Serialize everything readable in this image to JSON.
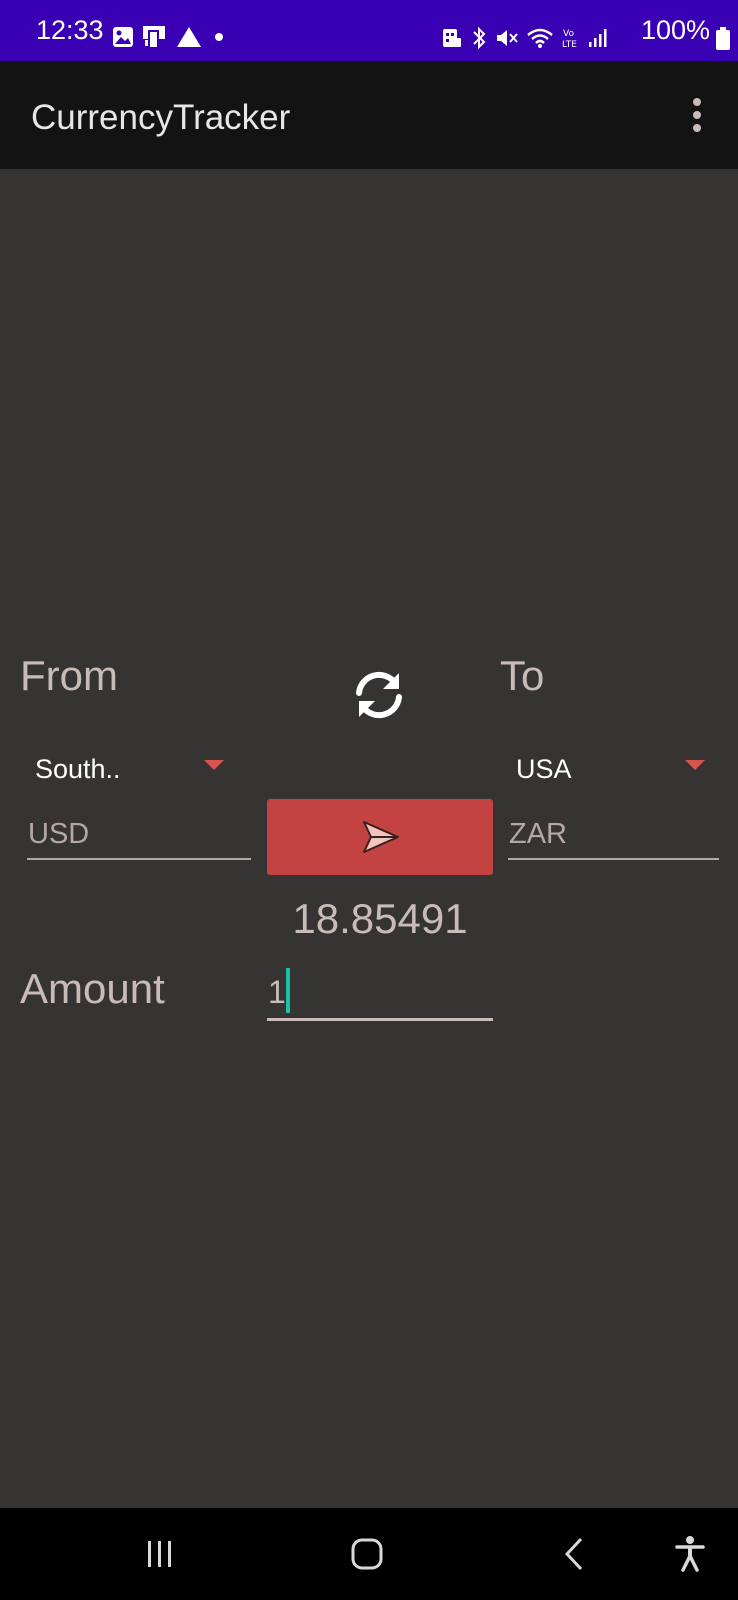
{
  "status_bar": {
    "time": "12:33",
    "battery": "100%",
    "left_icons": [
      "gallery-icon",
      "screen-cast-icon",
      "drive-icon",
      "dot-icon"
    ],
    "right_icons": [
      "nfc-icon",
      "bluetooth-icon",
      "mute-icon",
      "wifi-icon",
      "volte-icon",
      "signal-icon",
      "battery-icon"
    ]
  },
  "app_bar": {
    "title": "CurrencyTracker",
    "menu_icon": "overflow-menu-icon"
  },
  "converter": {
    "from_label": "From",
    "to_label": "To",
    "swap_icon": "swap-refresh-icon",
    "from_country": "South..",
    "to_country": "USA",
    "from_code": "USD",
    "to_code": "ZAR",
    "convert_icon": "send-icon",
    "result": "18.85491",
    "amount_label": "Amount",
    "amount_value": "1"
  },
  "nav_bar": {
    "icons": [
      "recents-icon",
      "home-icon",
      "back-icon",
      "accessibility-icon"
    ]
  },
  "colors": {
    "status_bar": "#3a00b3",
    "app_bar": "#131313",
    "background": "#353433",
    "accent": "#c24341",
    "text_muted": "#c9bbb8",
    "cursor": "#19c3a8"
  }
}
